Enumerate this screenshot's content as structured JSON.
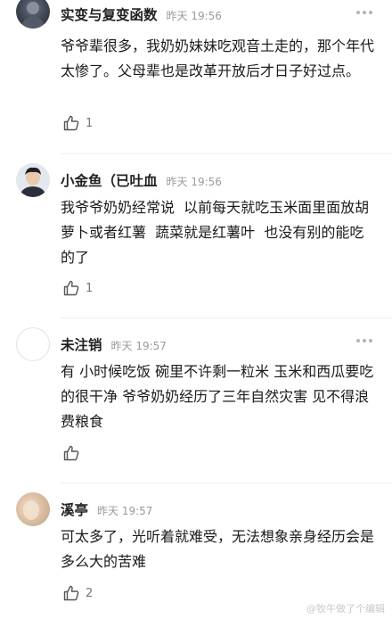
{
  "comments": [
    {
      "username": "实变与复变函数",
      "time": "昨天 19:56",
      "text": "爷爷辈很多，我奶奶妹妹吃观音土走的，那个年代太惨了。父母辈也是改革开放后才日子好过点。",
      "likes": "1"
    },
    {
      "username": "小金鱼（已吐血",
      "time": "昨天 19:56",
      "text": "我爷爷奶奶经常说  以前每天就吃玉米面里面放胡萝卜或者红薯  蔬菜就是红薯叶  也没有别的能吃的了",
      "likes": "1"
    },
    {
      "username": "未注销",
      "time": "昨天 19:57",
      "text": "有 小时候吃饭 碗里不许剩一粒米 玉米和西瓜要吃的很干净 爷爷奶奶经历了三年自然灾害 见不得浪费粮食",
      "likes": ""
    },
    {
      "username": "溪亭",
      "time": "昨天 19:57",
      "text": "可太多了，光听着就难受，无法想象亲身经历会是多么大的苦难",
      "likes": "2"
    }
  ],
  "watermark": "@牧牛做了个编辑",
  "icons": {
    "like": "thumbs-up-icon",
    "more": "more-dots-icon"
  }
}
